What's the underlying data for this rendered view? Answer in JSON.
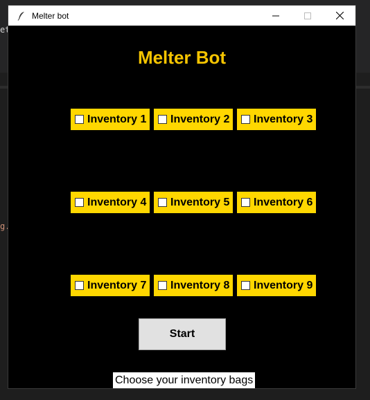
{
  "background": {
    "fragment_top": "et",
    "fragment_mid": "g."
  },
  "window": {
    "title": "Melter bot",
    "icon": "feather-icon",
    "controls": [
      "minimize-icon",
      "maximize-icon",
      "close-icon"
    ]
  },
  "app": {
    "heading": "Melter Bot",
    "accent_color": "#f5c400",
    "checkbox_color": "#ffd700",
    "inventories": [
      {
        "label": "Inventory 1",
        "checked": false
      },
      {
        "label": "Inventory 2",
        "checked": false
      },
      {
        "label": "Inventory 3",
        "checked": false
      },
      {
        "label": "Inventory 4",
        "checked": false
      },
      {
        "label": "Inventory 5",
        "checked": false
      },
      {
        "label": "Inventory 6",
        "checked": false
      },
      {
        "label": "Inventory 7",
        "checked": false
      },
      {
        "label": "Inventory 8",
        "checked": false
      },
      {
        "label": "Inventory 9",
        "checked": false
      }
    ],
    "start_label": "Start",
    "status_text": "Choose your inventory bags"
  }
}
